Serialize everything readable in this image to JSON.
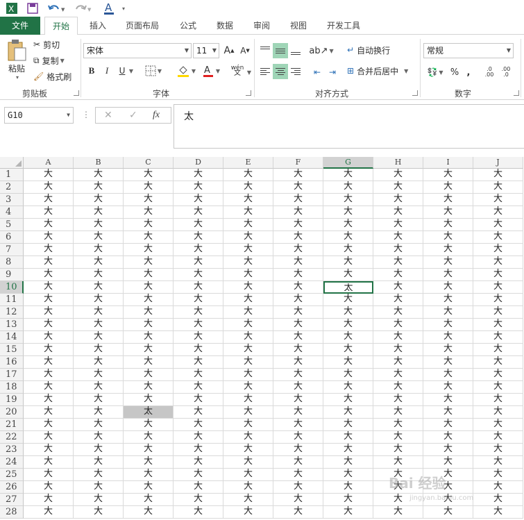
{
  "colors": {
    "accent": "#217346",
    "highlight": "#9fd5b7",
    "selected_cell_bg": "#c6c6c6",
    "font_underline_red": "#e02020",
    "fill_yellow": "#ffd800"
  },
  "qat": {
    "icons": [
      "excel-logo-icon",
      "save-icon",
      "undo-icon",
      "redo-icon",
      "font-color-qat-icon",
      "customize-qat-icon"
    ]
  },
  "tabs": [
    {
      "label": "文件",
      "kind": "file"
    },
    {
      "label": "开始",
      "kind": "active"
    },
    {
      "label": "插入"
    },
    {
      "label": "页面布局"
    },
    {
      "label": "公式"
    },
    {
      "label": "数据"
    },
    {
      "label": "审阅"
    },
    {
      "label": "视图"
    },
    {
      "label": "开发工具"
    }
  ],
  "ribbon": {
    "clipboard": {
      "paste": "粘贴",
      "cut": "剪切",
      "copy": "复制",
      "format_painter": "格式刷",
      "group": "剪贴板"
    },
    "font": {
      "name": "宋体",
      "size": "11",
      "bold": "B",
      "italic": "I",
      "underline": "U",
      "phonetic": "wén",
      "group": "字体"
    },
    "alignment": {
      "wrap": "自动换行",
      "merge": "合并后居中",
      "group": "对齐方式"
    },
    "number": {
      "format": "常规",
      "percent": "%",
      "comma": ",",
      "inc_dec": ".0 .00",
      "dec_dec": ".00 .0",
      "group": "数字"
    }
  },
  "formula_bar": {
    "name_box": "G10",
    "fx": "fx",
    "content": "太"
  },
  "sheet": {
    "columns": [
      "A",
      "B",
      "C",
      "D",
      "E",
      "F",
      "G",
      "H",
      "I",
      "J"
    ],
    "rows": [
      "1",
      "2",
      "3",
      "4",
      "5",
      "6",
      "7",
      "8",
      "9",
      "10",
      "11",
      "12",
      "13",
      "14",
      "15",
      "16",
      "17",
      "18",
      "19",
      "20",
      "21",
      "22",
      "23",
      "24",
      "25",
      "26",
      "27",
      "28"
    ],
    "default_value": "大",
    "special": [
      {
        "row": "10",
        "col": "G",
        "value": "太",
        "state": "active"
      },
      {
        "row": "20",
        "col": "C",
        "value": "太",
        "state": "highlight"
      }
    ],
    "selected_col": "G",
    "selected_row": "10",
    "highlight_col": "C",
    "highlight_row": "20"
  },
  "watermark": {
    "text": "Bai 经验",
    "sub": "jingyan.baidu.com"
  }
}
